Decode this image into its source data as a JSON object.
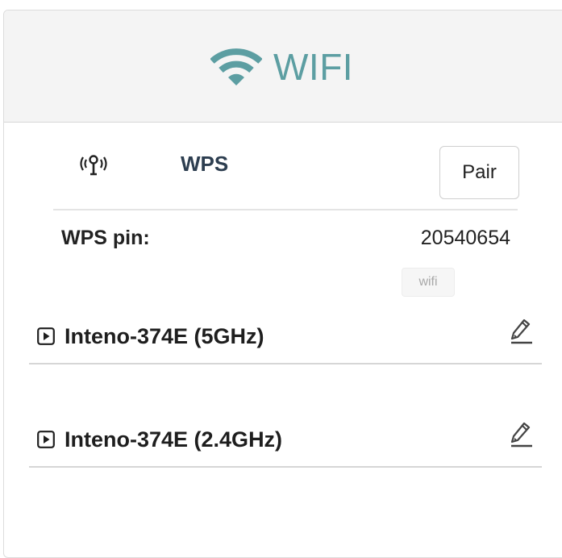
{
  "header": {
    "title": "WIFI",
    "icon": "wifi-icon",
    "accent_color": "#5c9ea2"
  },
  "wps": {
    "icon": "wps-antenna-icon",
    "label": "WPS",
    "pair_label": "Pair",
    "pin_label": "WPS pin:",
    "pin_value": "20540654",
    "tag": "wifi"
  },
  "networks": [
    {
      "name": "Inteno-374E (5GHz)",
      "icon": "expand-icon",
      "action_icon": "edit-icon"
    },
    {
      "name": "Inteno-374E (2.4GHz)",
      "icon": "expand-icon",
      "action_icon": "edit-icon"
    }
  ]
}
